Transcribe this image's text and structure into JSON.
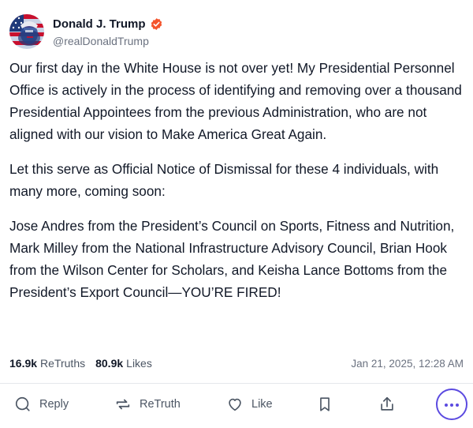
{
  "post": {
    "author": {
      "name": "Donald J. Trump",
      "handle": "@realDonaldTrump",
      "avatar_icon": "flag-portrait-avatar",
      "verified_icon": "verified-badge-icon",
      "verified_color": "#f4542c"
    },
    "paragraphs": [
      "Our first day in the White House is not over yet! My Presidential Personnel Office is actively in the process of identifying and removing over a thousand Presidential Appointees from the previous Administration, who are not aligned with our vision to Make America Great Again.",
      "Let this serve as Official Notice of Dismissal for these 4 individuals, with many more, coming soon:",
      "Jose Andres from the President’s Council on Sports, Fitness and Nutrition, Mark Milley from the National Infrastructure Advisory Council, Brian Hook from the Wilson Center for Scholars, and Keisha Lance Bottoms from the President’s Export Council—YOU’RE FIRED!"
    ],
    "stats": {
      "retruths_count": "16.9k",
      "retruths_label": "ReTruths",
      "likes_count": "80.9k",
      "likes_label": "Likes",
      "timestamp": "Jan 21, 2025, 12:28 AM"
    }
  },
  "actions": {
    "reply_label": "Reply",
    "retruth_label": "ReTruth",
    "like_label": "Like",
    "icons": [
      "reply-icon",
      "retruth-icon",
      "like-heart-icon",
      "bookmark-icon",
      "share-icon",
      "more-icon"
    ],
    "accent_color": "#5b4ae0"
  }
}
